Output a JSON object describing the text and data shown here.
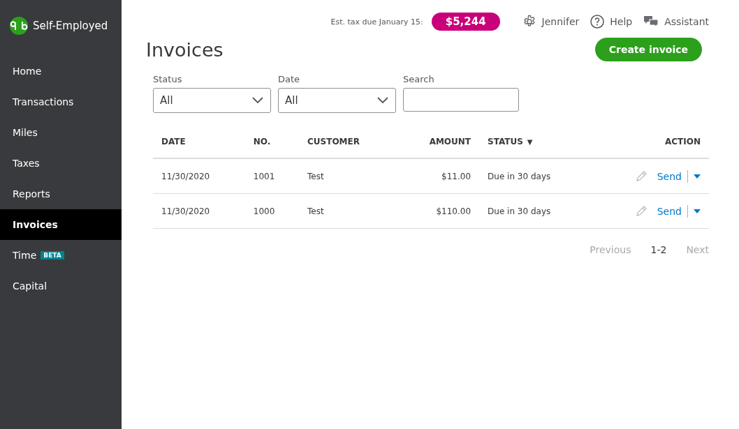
{
  "app": {
    "name": "Self-Employed"
  },
  "sidebar": {
    "items": [
      {
        "label": "Home",
        "selected": false
      },
      {
        "label": "Transactions",
        "selected": false
      },
      {
        "label": "Miles",
        "selected": false
      },
      {
        "label": "Taxes",
        "selected": false
      },
      {
        "label": "Reports",
        "selected": false
      },
      {
        "label": "Invoices",
        "selected": true
      },
      {
        "label": "Time",
        "selected": false,
        "badge": "BETA"
      },
      {
        "label": "Capital",
        "selected": false
      }
    ]
  },
  "header": {
    "tax_label": "Est. tax due January 15:",
    "tax_amount": "$5,244",
    "user": "Jennifer",
    "help": "Help",
    "assistant": "Assistant"
  },
  "page": {
    "title": "Invoices",
    "create_button": "Create invoice"
  },
  "filters": [
    {
      "kind": "select",
      "label": "Status",
      "value": "All"
    },
    {
      "kind": "select",
      "label": "Date",
      "value": "All"
    },
    {
      "kind": "text",
      "label": "Search"
    }
  ],
  "table": {
    "columns": [
      {
        "label": "DATE",
        "kind": "text"
      },
      {
        "label": "NO.",
        "kind": "text"
      },
      {
        "label": "CUSTOMER",
        "kind": "text"
      },
      {
        "label": "AMOUNT",
        "kind": "money"
      },
      {
        "label": "STATUS",
        "kind": "text",
        "sort": "▼"
      },
      {
        "label": "ACTION",
        "kind": "action"
      }
    ],
    "rows": [
      {
        "date": "11/30/2020",
        "no": "1001",
        "customer": "Test",
        "amount": "$11.00",
        "status": "Due in 30 days",
        "action": "Send"
      },
      {
        "date": "11/30/2020",
        "no": "1000",
        "customer": "Test",
        "amount": "$110.00",
        "status": "Due in 30 days",
        "action": "Send"
      }
    ]
  },
  "pagination": {
    "previous": {
      "label": "Previous",
      "disabled": true
    },
    "range": "1-2",
    "next": {
      "label": "Next",
      "disabled": true
    }
  }
}
